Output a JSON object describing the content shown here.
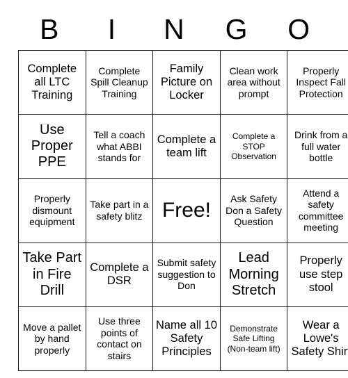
{
  "card": {
    "title": "BINGO",
    "header_letters": [
      "B",
      "I",
      "N",
      "G",
      "O"
    ],
    "rows": [
      [
        {
          "text": "Complete all LTC Training",
          "size": "sz-md"
        },
        {
          "text": "Complete Spill Cleanup Training",
          "size": "sz-sm"
        },
        {
          "text": "Family Picture on Locker",
          "size": "sz-md"
        },
        {
          "text": "Clean work area without prompt",
          "size": "sz-sm"
        },
        {
          "text": "Properly Inspect Fall Protection",
          "size": "sz-sm"
        }
      ],
      [
        {
          "text": "Use Proper PPE",
          "size": "sz-lg"
        },
        {
          "text": "Tell a coach what ABBI stands for",
          "size": "sz-sm"
        },
        {
          "text": "Complete a team lift",
          "size": "sz-md"
        },
        {
          "text": "Complete a STOP Observation",
          "size": "sz-xs"
        },
        {
          "text": "Drink from a full water bottle",
          "size": "sz-sm"
        }
      ],
      [
        {
          "text": "Properly dismount equipment",
          "size": "sz-sm"
        },
        {
          "text": "Take part in a safety blitz",
          "size": "sz-sm"
        },
        {
          "text": "Free!",
          "size": "sz-xl"
        },
        {
          "text": "Ask Safety Don a Safety Question",
          "size": "sz-sm"
        },
        {
          "text": "Attend a safety committee meeting",
          "size": "sz-sm"
        }
      ],
      [
        {
          "text": "Take Part in Fire Drill",
          "size": "sz-lg"
        },
        {
          "text": "Complete a DSR",
          "size": "sz-md"
        },
        {
          "text": "Submit safety suggestion to Don",
          "size": "sz-sm"
        },
        {
          "text": "Lead Morning Stretch",
          "size": "sz-lg"
        },
        {
          "text": "Properly use step stool",
          "size": "sz-md"
        }
      ],
      [
        {
          "text": "Move a pallet by hand properly",
          "size": "sz-sm"
        },
        {
          "text": "Use three points of contact on stairs",
          "size": "sz-sm"
        },
        {
          "text": "Name all 10 Safety Principles",
          "size": "sz-md"
        },
        {
          "text": "Demonstrate Safe Lifting (Non-team lift)",
          "size": "sz-xs"
        },
        {
          "text": "Wear a Lowe's Safety Shirt",
          "size": "sz-md"
        }
      ]
    ],
    "free_space": {
      "row": 2,
      "col": 2,
      "label": "Free!"
    },
    "colors": {
      "background": "#ffffff",
      "text": "#000000",
      "border": "#1a1a1a"
    }
  }
}
